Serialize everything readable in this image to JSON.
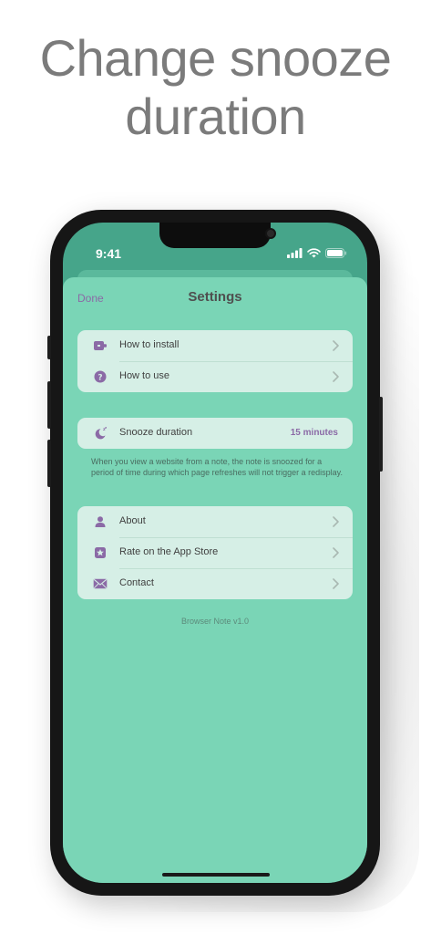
{
  "headline": {
    "line1": "Change snooze",
    "line2": "duration"
  },
  "status_bar": {
    "time": "9:41"
  },
  "nav": {
    "done_label": "Done",
    "title": "Settings"
  },
  "groups": {
    "help": [
      {
        "label": "How to install",
        "icon": "extension-icon"
      },
      {
        "label": "How to use",
        "icon": "help-icon"
      }
    ],
    "snooze": {
      "label": "Snooze duration",
      "icon": "moon-zzz-icon",
      "value": "15 minutes",
      "description": "When you view a website from a note, the note is snoozed for a period of time during which page refreshes will not trigger a redisplay."
    },
    "info": [
      {
        "label": "About",
        "icon": "person-icon"
      },
      {
        "label": "Rate on the App Store",
        "icon": "star-icon"
      },
      {
        "label": "Contact",
        "icon": "envelope-icon"
      }
    ]
  },
  "footer": {
    "version": "Browser Note v1.0"
  },
  "colors": {
    "sheet": "#7ad5b6",
    "group": "#d6efe6",
    "accent": "#8b6aa6",
    "headline": "#7b7b7b"
  }
}
